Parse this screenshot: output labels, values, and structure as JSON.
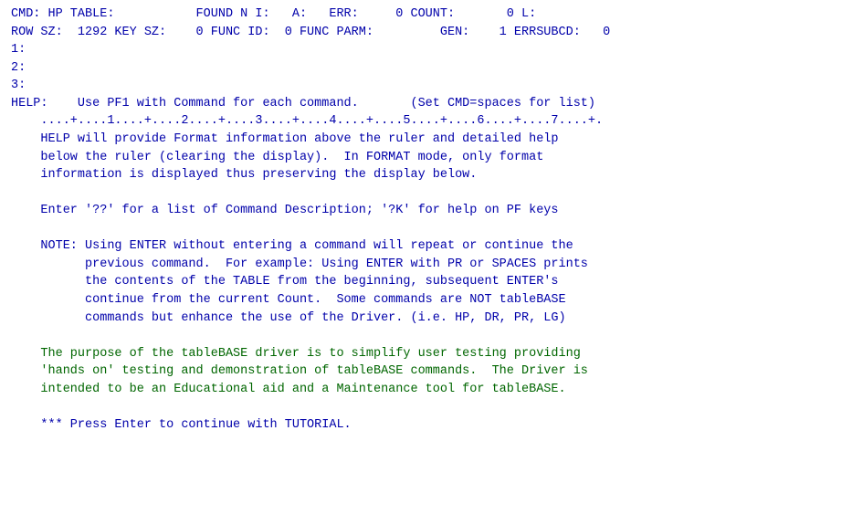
{
  "terminal": {
    "lines": [
      {
        "id": "line1",
        "text": "CMD: HP TABLE:           FOUND N I:   A:   ERR:     0 COUNT:       0 L:",
        "type": "normal"
      },
      {
        "id": "line2",
        "text": "ROW SZ:  1292 KEY SZ:    0 FUNC ID:  0 FUNC PARM:         GEN:    1 ERRSUBCD:   0",
        "type": "normal"
      },
      {
        "id": "line3",
        "text": "1:",
        "type": "normal"
      },
      {
        "id": "line4",
        "text": "2:",
        "type": "normal"
      },
      {
        "id": "line5",
        "text": "3:",
        "type": "normal"
      },
      {
        "id": "line6",
        "text": "HELP:    Use PF1 with Command for each command.       (Set CMD=spaces for list)",
        "type": "normal"
      },
      {
        "id": "line7",
        "text": "    ....+....1....+....2....+....3....+....4....+....5....+....6....+....7....+.",
        "type": "normal"
      },
      {
        "id": "line8",
        "text": "    HELP will provide Format information above the ruler and detailed help",
        "type": "normal"
      },
      {
        "id": "line9",
        "text": "    below the ruler (clearing the display).  In FORMAT mode, only format",
        "type": "normal"
      },
      {
        "id": "line10",
        "text": "    information is displayed thus preserving the display below.",
        "type": "normal"
      },
      {
        "id": "line11",
        "text": "",
        "type": "blank"
      },
      {
        "id": "line12",
        "text": "    Enter '??' for a list of Command Description; '?K' for help on PF keys",
        "type": "normal"
      },
      {
        "id": "line13",
        "text": "",
        "type": "blank"
      },
      {
        "id": "line14",
        "text": "    NOTE: Using ENTER without entering a command will repeat or continue the",
        "type": "normal"
      },
      {
        "id": "line15",
        "text": "          previous command.  For example: Using ENTER with PR or SPACES prints",
        "type": "normal"
      },
      {
        "id": "line16",
        "text": "          the contents of the TABLE from the beginning, subsequent ENTER's",
        "type": "normal"
      },
      {
        "id": "line17",
        "text": "          continue from the current Count.  Some commands are NOT tableBASE",
        "type": "normal"
      },
      {
        "id": "line18",
        "text": "          commands but enhance the use of the Driver. (i.e. HP, DR, PR, LG)",
        "type": "normal"
      },
      {
        "id": "line19",
        "text": "",
        "type": "blank"
      },
      {
        "id": "line20",
        "text": "    The purpose of the tableBASE driver is to simplify user testing providing",
        "type": "green"
      },
      {
        "id": "line21",
        "text": "    'hands on' testing and demonstration of tableBASE commands.  The Driver is",
        "type": "green"
      },
      {
        "id": "line22",
        "text": "    intended to be an Educational aid and a Maintenance tool for tableBASE.",
        "type": "green"
      },
      {
        "id": "line23",
        "text": "",
        "type": "blank"
      },
      {
        "id": "line24",
        "text": "    *** Press Enter to continue with TUTORIAL.",
        "type": "normal"
      }
    ]
  }
}
